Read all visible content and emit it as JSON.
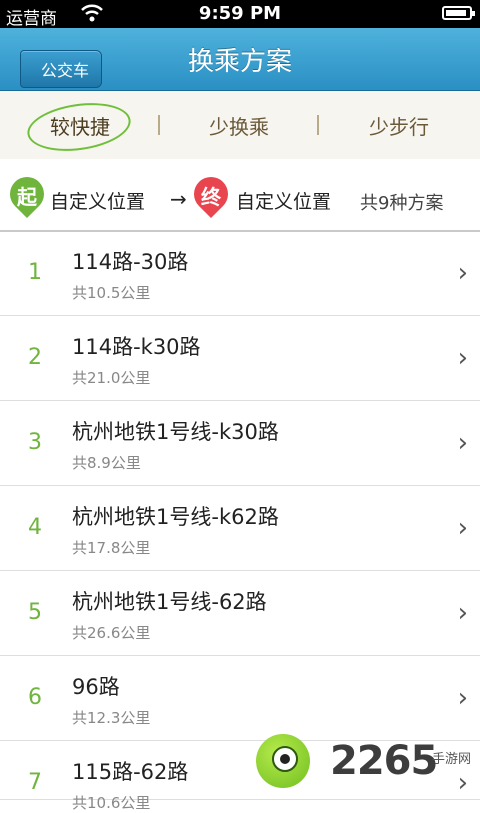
{
  "status": {
    "carrier": "运营商",
    "time": "9:59 PM",
    "battery_level": 0.9
  },
  "nav": {
    "back_label": "公交车",
    "title": "换乘方案"
  },
  "tabs": [
    {
      "label": "较快捷",
      "selected": true
    },
    {
      "label": "少换乘",
      "selected": false
    },
    {
      "label": "少步行",
      "selected": false
    }
  ],
  "route": {
    "start_badge": "起",
    "start_label": "自定义位置",
    "arrow": "→",
    "end_badge": "终",
    "end_label": "自定义位置",
    "plan_count": "共9种方案"
  },
  "plans": [
    {
      "index": "1",
      "name": "114路-30路",
      "distance": "共10.5公里"
    },
    {
      "index": "2",
      "name": "114路-k30路",
      "distance": "共21.0公里"
    },
    {
      "index": "3",
      "name": "杭州地铁1号线-k30路",
      "distance": "共8.9公里"
    },
    {
      "index": "4",
      "name": "杭州地铁1号线-k62路",
      "distance": "共17.8公里"
    },
    {
      "index": "5",
      "name": "杭州地铁1号线-62路",
      "distance": "共26.6公里"
    },
    {
      "index": "6",
      "name": "96路",
      "distance": "共12.3公里"
    },
    {
      "index": "7",
      "name": "115路-62路",
      "distance": "共10.6公里"
    }
  ],
  "watermark": {
    "number": "2265",
    "text": "手游网"
  },
  "colors": {
    "nav_bar": "#2a8fc4",
    "accent_green": "#6fb43c",
    "start_pin": "#6fb43c",
    "end_pin": "#e8454f"
  },
  "icons": {
    "wifi": "wifi-icon",
    "battery": "battery-icon",
    "chevron": "chevron-right-icon"
  }
}
